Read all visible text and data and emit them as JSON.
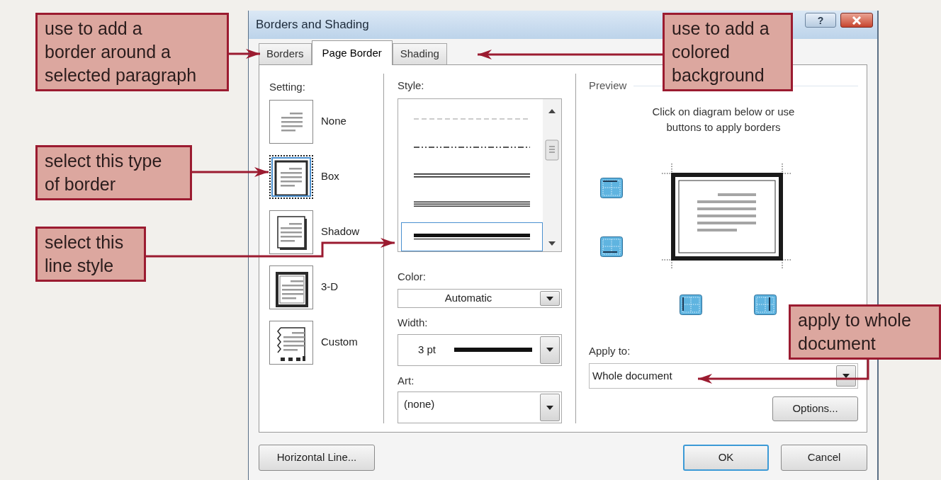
{
  "dialog": {
    "title": "Borders and Shading",
    "help_button": "?"
  },
  "tabs": [
    {
      "label": "Borders",
      "selected": false
    },
    {
      "label": "Page Border",
      "selected": true
    },
    {
      "label": "Shading",
      "selected": false
    }
  ],
  "setting": {
    "label": "Setting:",
    "options": [
      {
        "kind": "none",
        "label": "None",
        "selected": false
      },
      {
        "kind": "box",
        "label": "Box",
        "selected": true
      },
      {
        "kind": "shadow",
        "label": "Shadow",
        "selected": false
      },
      {
        "kind": "threed",
        "label": "3-D",
        "selected": false
      },
      {
        "kind": "custom",
        "label": "Custom",
        "selected": false
      }
    ]
  },
  "style": {
    "label": "Style:",
    "options": [
      {
        "kind": "dashed",
        "selected": false
      },
      {
        "kind": "dash-dot",
        "selected": false
      },
      {
        "kind": "double",
        "selected": false
      },
      {
        "kind": "triple",
        "selected": false
      },
      {
        "kind": "thick-thin",
        "selected": true
      }
    ]
  },
  "color": {
    "label": "Color:",
    "value": "Automatic"
  },
  "width": {
    "label": "Width:",
    "value": "3 pt"
  },
  "art": {
    "label": "Art:",
    "value": "(none)"
  },
  "preview": {
    "label": "Preview",
    "hint_lines": [
      "Click on diagram below or use",
      "buttons to apply borders"
    ]
  },
  "apply_to": {
    "label": "Apply to:",
    "value": "Whole document"
  },
  "options_button": "Options...",
  "footer_buttons": [
    {
      "label": "Horizontal Line...",
      "default": false
    },
    {
      "label": "OK",
      "default": true
    },
    {
      "label": "Cancel",
      "default": false
    }
  ],
  "callouts": [
    {
      "lines": [
        "use to add a",
        "border around a",
        "selected paragraph"
      ]
    },
    {
      "lines": [
        "select this type",
        "of border"
      ]
    },
    {
      "lines": [
        "select this",
        "line style"
      ]
    },
    {
      "lines": [
        "use to add a",
        "colored",
        "background"
      ]
    },
    {
      "lines": [
        "apply to whole",
        "document"
      ]
    }
  ]
}
